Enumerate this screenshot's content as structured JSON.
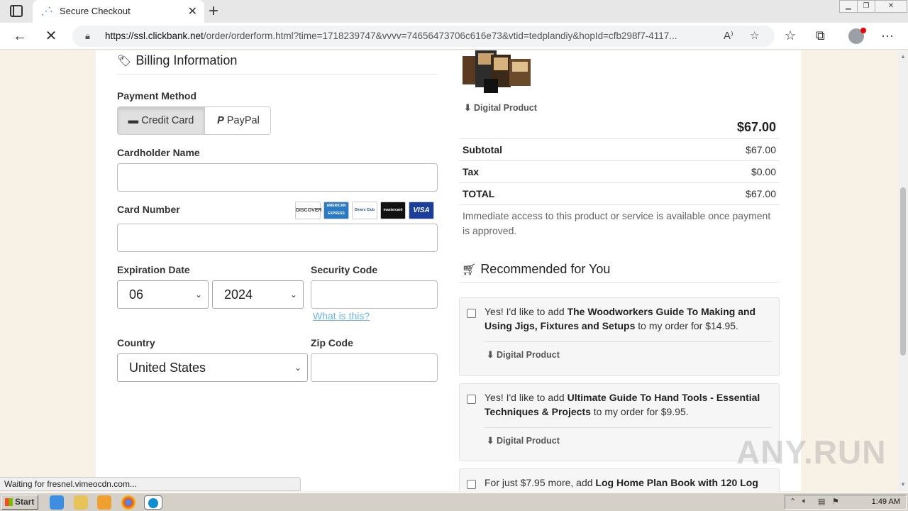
{
  "browser": {
    "tab_title": "Secure Checkout",
    "url_host": "https://ssl.clickbank.net",
    "url_path": "/order/orderform.html?time=1718239747&vvvv=74656473706c616e73&vtid=tedplandiy&hopId=cfb298f7-4117..."
  },
  "billing": {
    "title": "Billing Information",
    "payment_method_label": "Payment Method",
    "credit_card_label": "Credit Card",
    "paypal_label": "PayPal",
    "cardholder_label": "Cardholder Name",
    "cardholder_value": "",
    "card_number_label": "Card Number",
    "card_number_value": "",
    "card_brands": [
      "DISCOVER",
      "AMERICAN EXPRESS",
      "Diners Club",
      "mastercard",
      "VISA"
    ],
    "expiration_label": "Expiration Date",
    "exp_month": "06",
    "exp_year": "2024",
    "security_label": "Security Code",
    "security_value": "",
    "what_is_this": "What is this?",
    "country_label": "Country",
    "country_value": "United States",
    "zip_label": "Zip Code",
    "zip_value": ""
  },
  "summary": {
    "digital_product": "Digital Product",
    "price": "$67.00",
    "subtotal_label": "Subtotal",
    "subtotal_value": "$67.00",
    "tax_label": "Tax",
    "tax_value": "$0.00",
    "total_label": "TOTAL",
    "total_value": "$67.00",
    "notice": "Immediate access to this product or service is available once payment is approved."
  },
  "recommended": {
    "title": "Recommended for You",
    "items": [
      {
        "prefix": "Yes! I'd like to add ",
        "name": "The Woodworkers Guide To Making and Using Jigs, Fixtures and Setups",
        "suffix": " to my order for $14.95.",
        "tag": "Digital Product"
      },
      {
        "prefix": "Yes! I'd like to add ",
        "name": "Ultimate Guide To Hand Tools - Essential Techniques & Projects",
        "suffix": " to my order for $9.95.",
        "tag": "Digital Product"
      },
      {
        "prefix": "For just $7.95 more, add ",
        "name": "Log Home Plan Book with 120 Log",
        "suffix": "",
        "tag": ""
      }
    ]
  },
  "status": "Waiting for fresnel.vimeocdn.com...",
  "watermark": "ANY.RUN",
  "taskbar": {
    "start": "Start",
    "time": "1:49 AM"
  }
}
